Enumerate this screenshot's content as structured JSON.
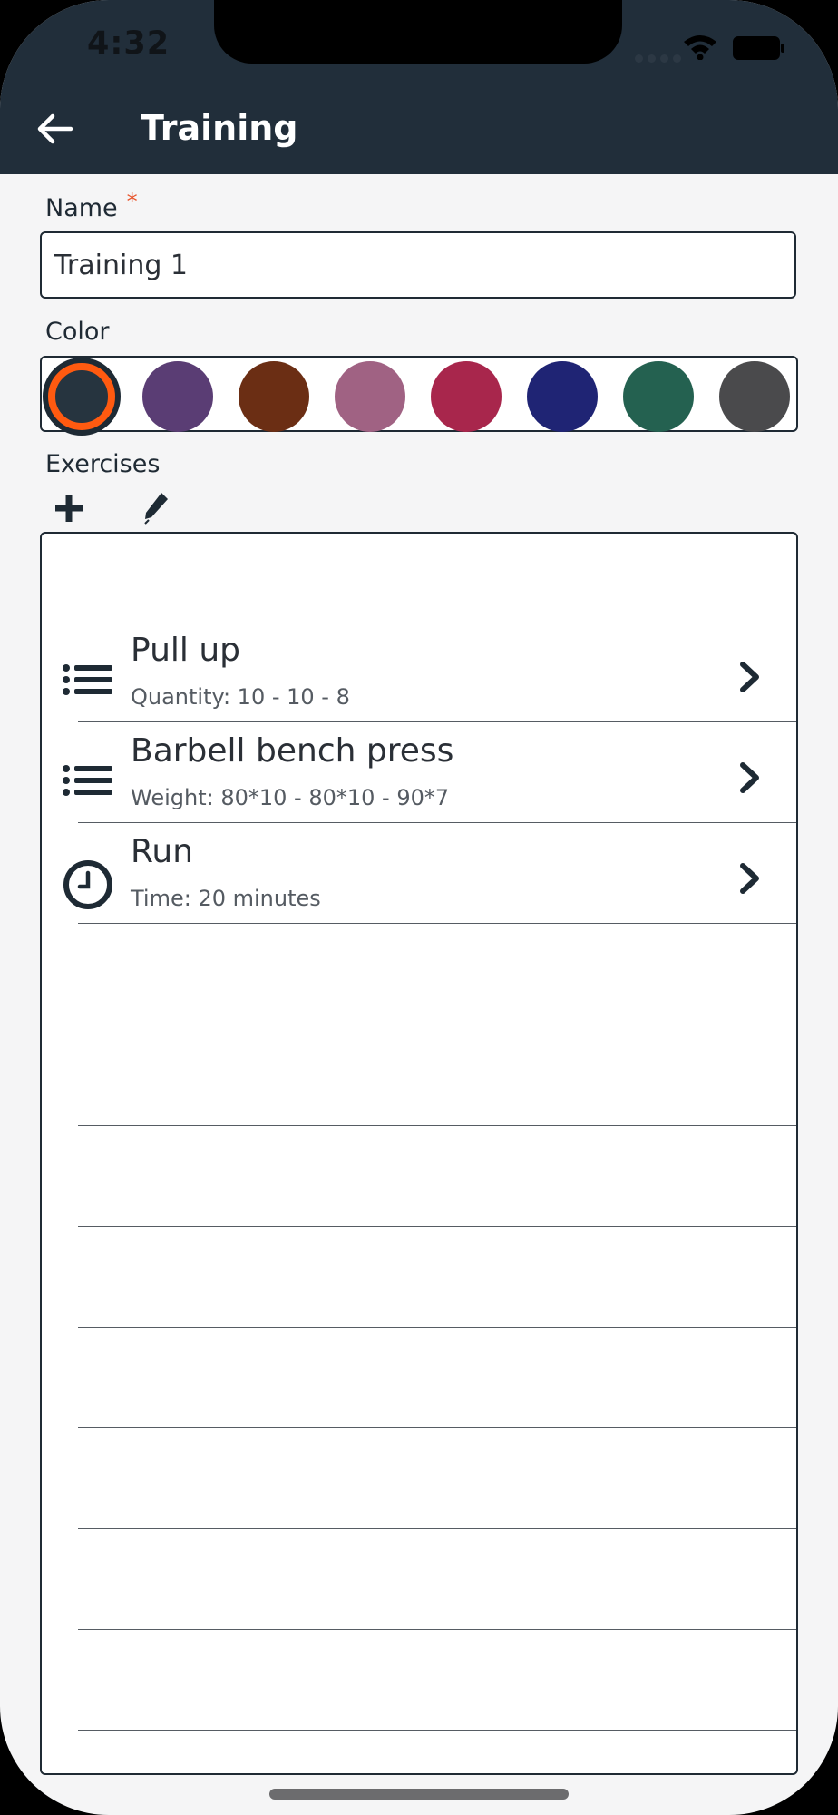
{
  "status_bar": {
    "time": "4:32"
  },
  "header": {
    "title": "Training"
  },
  "form": {
    "name_label": "Name",
    "required_mark": "*",
    "name_value": "Training 1",
    "color_label": "Color",
    "exercises_label": "Exercises"
  },
  "colors": [
    "#26343f",
    "#5a3d74",
    "#6b2e14",
    "#a06283",
    "#a8264c",
    "#1f2474",
    "#246150",
    "#4a4a4c"
  ],
  "selected_color_index": 0,
  "exercises": [
    {
      "icon": "list-icon",
      "name": "Pull up",
      "detail": "Quantity: 10 - 10 - 8"
    },
    {
      "icon": "list-icon",
      "name": "Barbell bench press",
      "detail": "Weight: 80*10 - 80*10 - 90*7"
    },
    {
      "icon": "clock-icon",
      "name": "Run",
      "detail": "Time: 20 minutes"
    }
  ],
  "theme": {
    "header_bg": "#212e3a",
    "selected_ring": "#ff5a10",
    "required": "#e8532a"
  }
}
